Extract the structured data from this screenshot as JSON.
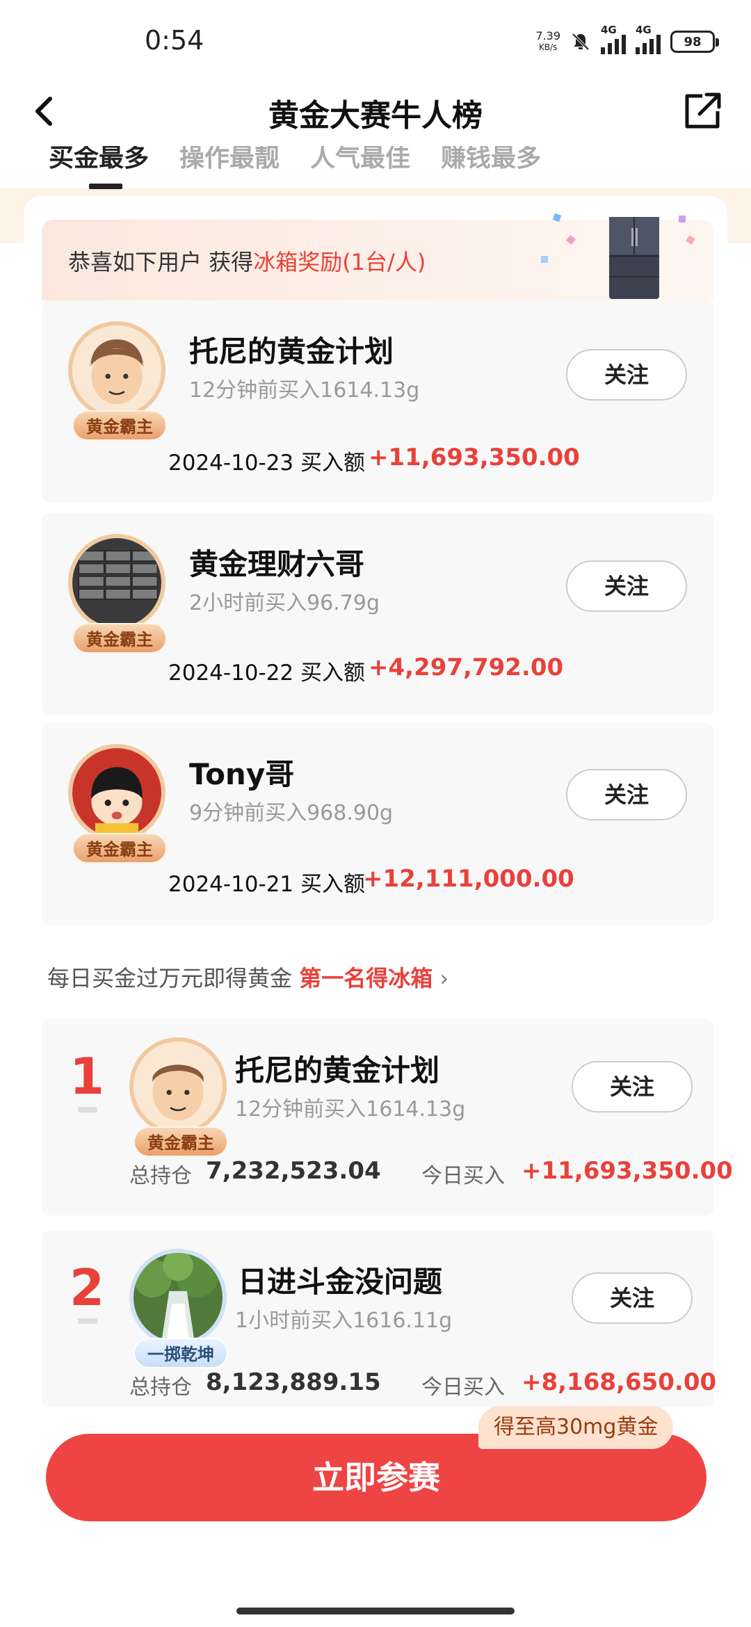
{
  "status_bar": {
    "time": "0:54",
    "net_speed_value": "7.39",
    "net_speed_unit": "KB/s",
    "network_1": "4G",
    "network_2": "4G",
    "battery": "98"
  },
  "nav": {
    "title": "黄金大赛牛人榜"
  },
  "tabs": [
    "买金最多",
    "操作最靓",
    "人气最佳",
    "赚钱最多"
  ],
  "reward_banner": {
    "prefix": "恭喜如下用户 获得",
    "highlight": "冰箱奖励(1台/人)"
  },
  "winners": [
    {
      "name": "托尼的黄金计划",
      "sub": "12分钟前买入1614.13g",
      "badge": "黄金霸主",
      "follow": "关注",
      "date": "2024-10-23 买入额",
      "amount": "+11,693,350.00"
    },
    {
      "name": "黄金理财六哥",
      "sub": "2小时前买入96.79g",
      "badge": "黄金霸主",
      "follow": "关注",
      "date": "2024-10-22 买入额",
      "amount": "+4,297,792.00"
    },
    {
      "name": "Tony哥",
      "sub": "9分钟前买入968.90g",
      "badge": "黄金霸主",
      "follow": "关注",
      "date": "2024-10-21 买入额",
      "amount": "+12,111,000.00"
    }
  ],
  "daily_tip": {
    "text": "每日买金过万元即得黄金",
    "highlight": "第一名得冰箱",
    "chevron": "›"
  },
  "ranking": [
    {
      "rank": "1",
      "name": "托尼的黄金计划",
      "sub": "12分钟前买入1614.13g",
      "badge": "黄金霸主",
      "follow": "关注",
      "hold_label": "总持仓",
      "hold": "7,232,523.04",
      "today_label": "今日买入",
      "today": "+11,693,350.00"
    },
    {
      "rank": "2",
      "name": "日进斗金没问题",
      "sub": "1小时前买入1616.11g",
      "badge": "一掷乾坤",
      "follow": "关注",
      "hold_label": "总持仓",
      "hold": "8,123,889.15",
      "today_label": "今日买入",
      "today": "+8,168,650.00"
    }
  ],
  "cta": {
    "label": "立即参赛",
    "promo": "得至高30mg黄金"
  },
  "colors": {
    "accent_red": "#e8413a",
    "button_red": "#ef4444",
    "badge_gold": "#e9a06b"
  }
}
